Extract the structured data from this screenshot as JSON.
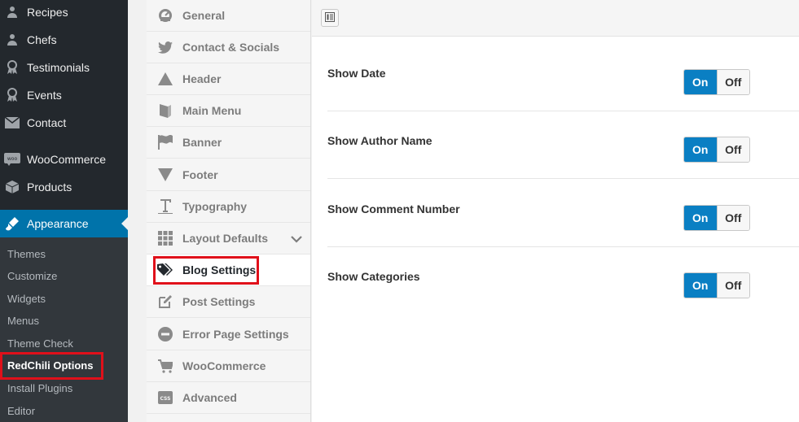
{
  "wp_menu": {
    "items": [
      {
        "label": "Recipes",
        "icon": "user-icon"
      },
      {
        "label": "Chefs",
        "icon": "user-icon"
      },
      {
        "label": "Testimonials",
        "icon": "award-icon"
      },
      {
        "label": "Events",
        "icon": "award-icon"
      },
      {
        "label": "Contact",
        "icon": "mail-icon"
      },
      {
        "label": "WooCommerce",
        "icon": "woocommerce-icon"
      },
      {
        "label": "Products",
        "icon": "box-icon"
      },
      {
        "label": "Appearance",
        "icon": "brush-icon"
      }
    ],
    "submenu": [
      "Themes",
      "Customize",
      "Widgets",
      "Menus",
      "Theme Check",
      "RedChili Options",
      "Install Plugins",
      "Editor"
    ]
  },
  "options_nav": {
    "items": [
      {
        "label": "General",
        "icon": "dashboard-icon"
      },
      {
        "label": "Contact & Socials",
        "icon": "twitter-icon"
      },
      {
        "label": "Header",
        "icon": "triangle-up-icon"
      },
      {
        "label": "Main Menu",
        "icon": "book-icon"
      },
      {
        "label": "Banner",
        "icon": "flag-icon"
      },
      {
        "label": "Footer",
        "icon": "triangle-down-icon"
      },
      {
        "label": "Typography",
        "icon": "text-icon"
      },
      {
        "label": "Layout Defaults",
        "icon": "grid-icon"
      },
      {
        "label": "Blog Settings",
        "icon": "tags-icon"
      },
      {
        "label": "Post Settings",
        "icon": "edit-icon"
      },
      {
        "label": "Error Page Settings",
        "icon": "minus-circle-icon"
      },
      {
        "label": "WooCommerce",
        "icon": "cart-icon"
      },
      {
        "label": "Advanced",
        "icon": "css-icon"
      }
    ]
  },
  "settings": [
    {
      "label": "Show Date",
      "on": "On",
      "off": "Off",
      "value": "on"
    },
    {
      "label": "Show Author Name",
      "on": "On",
      "off": "Off",
      "value": "on"
    },
    {
      "label": "Show Comment Number",
      "on": "On",
      "off": "Off",
      "value": "on"
    },
    {
      "label": "Show Categories",
      "on": "On",
      "off": "Off",
      "value": "on"
    }
  ],
  "colors": {
    "accent": "#0073aa",
    "switch_on": "#0a7fc3",
    "highlight": "#e0101a"
  }
}
